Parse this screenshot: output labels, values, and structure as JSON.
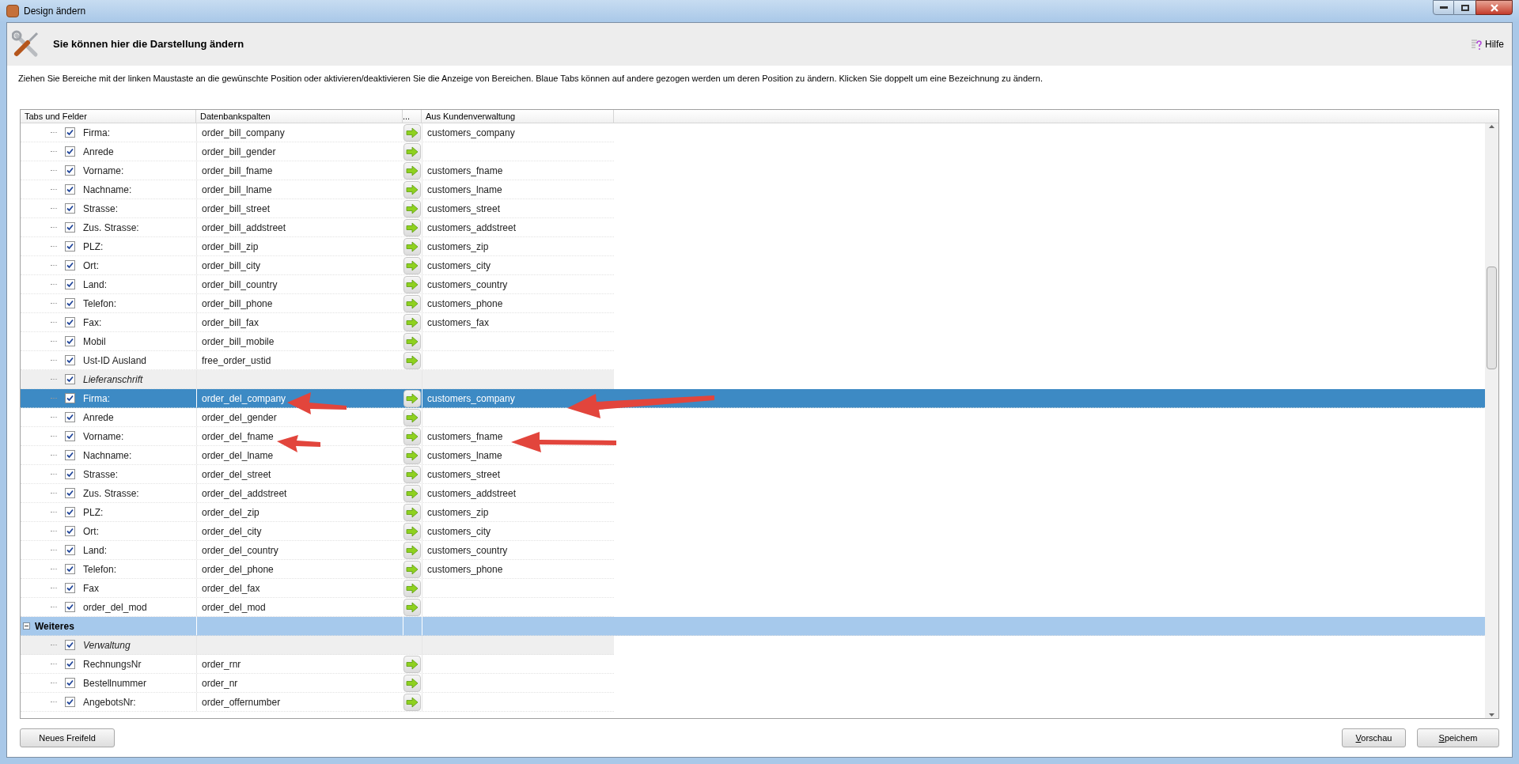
{
  "window": {
    "title": "Design ändern"
  },
  "header": {
    "title": "Sie können hier die Darstellung ändern",
    "help": "Hilfe"
  },
  "description": "Ziehen Sie Bereiche mit der linken Maustaste an die gewünschte Position oder aktivieren/deaktivieren Sie die Anzeige von Bereichen. Blaue Tabs können auf andere gezogen werden um deren Position zu ändern. Klicken Sie doppelt um eine Bezeichnung zu ändern.",
  "table": {
    "columns": [
      "Tabs und Felder",
      "Datenbankspalten",
      "...",
      "Aus Kundenverwaltung"
    ],
    "rows": [
      {
        "kind": "field",
        "label": "Firma:",
        "column": "order_bill_company",
        "source": "customers_company",
        "checked": true,
        "selected": false
      },
      {
        "kind": "field",
        "label": "Anrede",
        "column": "order_bill_gender",
        "source": "",
        "checked": true,
        "selected": false
      },
      {
        "kind": "field",
        "label": "Vorname:",
        "column": "order_bill_fname",
        "source": "customers_fname",
        "checked": true,
        "selected": false
      },
      {
        "kind": "field",
        "label": "Nachname:",
        "column": "order_bill_lname",
        "source": "customers_lname",
        "checked": true,
        "selected": false
      },
      {
        "kind": "field",
        "label": "Strasse:",
        "column": "order_bill_street",
        "source": "customers_street",
        "checked": true,
        "selected": false
      },
      {
        "kind": "field",
        "label": "Zus. Strasse:",
        "column": "order_bill_addstreet",
        "source": "customers_addstreet",
        "checked": true,
        "selected": false
      },
      {
        "kind": "field",
        "label": "PLZ:",
        "column": "order_bill_zip",
        "source": "customers_zip",
        "checked": true,
        "selected": false
      },
      {
        "kind": "field",
        "label": "Ort:",
        "column": "order_bill_city",
        "source": "customers_city",
        "checked": true,
        "selected": false
      },
      {
        "kind": "field",
        "label": "Land:",
        "column": "order_bill_country",
        "source": "customers_country",
        "checked": true,
        "selected": false
      },
      {
        "kind": "field",
        "label": "Telefon:",
        "column": "order_bill_phone",
        "source": "customers_phone",
        "checked": true,
        "selected": false
      },
      {
        "kind": "field",
        "label": "Fax:",
        "column": "order_bill_fax",
        "source": "customers_fax",
        "checked": true,
        "selected": false
      },
      {
        "kind": "field",
        "label": "Mobil",
        "column": "order_bill_mobile",
        "source": "",
        "checked": true,
        "selected": false
      },
      {
        "kind": "field",
        "label": "Ust-ID Ausland",
        "column": "free_order_ustid",
        "source": "",
        "checked": true,
        "selected": false
      },
      {
        "kind": "group",
        "label": "Lieferanschrift",
        "checked": true,
        "selected": false
      },
      {
        "kind": "field",
        "label": "Firma:",
        "column": "order_del_company",
        "source": "customers_company",
        "checked": true,
        "selected": true
      },
      {
        "kind": "field",
        "label": "Anrede",
        "column": "order_del_gender",
        "source": "",
        "checked": true,
        "selected": false
      },
      {
        "kind": "field",
        "label": "Vorname:",
        "column": "order_del_fname",
        "source": "customers_fname",
        "checked": true,
        "selected": false
      },
      {
        "kind": "field",
        "label": "Nachname:",
        "column": "order_del_lname",
        "source": "customers_lname",
        "checked": true,
        "selected": false
      },
      {
        "kind": "field",
        "label": "Strasse:",
        "column": "order_del_street",
        "source": "customers_street",
        "checked": true,
        "selected": false
      },
      {
        "kind": "field",
        "label": "Zus. Strasse:",
        "column": "order_del_addstreet",
        "source": "customers_addstreet",
        "checked": true,
        "selected": false
      },
      {
        "kind": "field",
        "label": "PLZ:",
        "column": "order_del_zip",
        "source": "customers_zip",
        "checked": true,
        "selected": false
      },
      {
        "kind": "field",
        "label": "Ort:",
        "column": "order_del_city",
        "source": "customers_city",
        "checked": true,
        "selected": false
      },
      {
        "kind": "field",
        "label": "Land:",
        "column": "order_del_country",
        "source": "customers_country",
        "checked": true,
        "selected": false
      },
      {
        "kind": "field",
        "label": "Telefon:",
        "column": "order_del_phone",
        "source": "customers_phone",
        "checked": true,
        "selected": false
      },
      {
        "kind": "field",
        "label": "Fax",
        "column": "order_del_fax",
        "source": "",
        "checked": true,
        "selected": false
      },
      {
        "kind": "field",
        "label": "order_del_mod",
        "column": "order_del_mod",
        "source": "",
        "checked": true,
        "selected": false
      },
      {
        "kind": "section",
        "label": "Weiteres",
        "expanded": true,
        "selected": false
      },
      {
        "kind": "group",
        "label": "Verwaltung",
        "checked": true,
        "selected": false
      },
      {
        "kind": "field",
        "label": "RechnungsNr",
        "column": "order_rnr",
        "source": "",
        "checked": true,
        "selected": false
      },
      {
        "kind": "field",
        "label": "Bestellnummer",
        "column": "order_nr",
        "source": "",
        "checked": true,
        "selected": false
      },
      {
        "kind": "field",
        "label": "AngebotsNr:",
        "column": "order_offernumber",
        "source": "",
        "checked": true,
        "selected": false
      }
    ]
  },
  "buttons": {
    "left": "Neues Freifeld",
    "preview": "Vorschau",
    "save": "Speichem"
  }
}
